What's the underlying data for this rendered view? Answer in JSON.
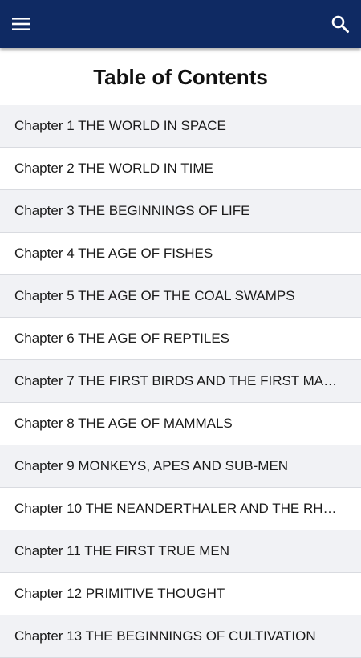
{
  "app_bar": {
    "menu_icon": "hamburger-menu-icon",
    "search_icon": "search-icon",
    "background_color": "#0f2a63"
  },
  "page": {
    "title": "Table of Contents"
  },
  "toc": {
    "items": [
      {
        "label": "Chapter 1 THE WORLD IN SPACE"
      },
      {
        "label": "Chapter 2 THE WORLD IN TIME"
      },
      {
        "label": "Chapter 3 THE BEGINNINGS OF LIFE"
      },
      {
        "label": "Chapter 4 THE AGE OF FISHES"
      },
      {
        "label": "Chapter 5 THE AGE OF THE COAL SWAMPS"
      },
      {
        "label": "Chapter 6 THE AGE OF REPTILES"
      },
      {
        "label": "Chapter 7 THE FIRST BIRDS AND THE FIRST MA…"
      },
      {
        "label": "Chapter 8 THE AGE OF MAMMALS"
      },
      {
        "label": "Chapter 9 MONKEYS, APES AND SUB-MEN"
      },
      {
        "label": "Chapter 10 THE NEANDERTHALER AND THE RH…"
      },
      {
        "label": "Chapter 11 THE FIRST TRUE MEN"
      },
      {
        "label": "Chapter 12 PRIMITIVE THOUGHT"
      },
      {
        "label": "Chapter 13 THE BEGINNINGS OF CULTIVATION"
      }
    ]
  }
}
